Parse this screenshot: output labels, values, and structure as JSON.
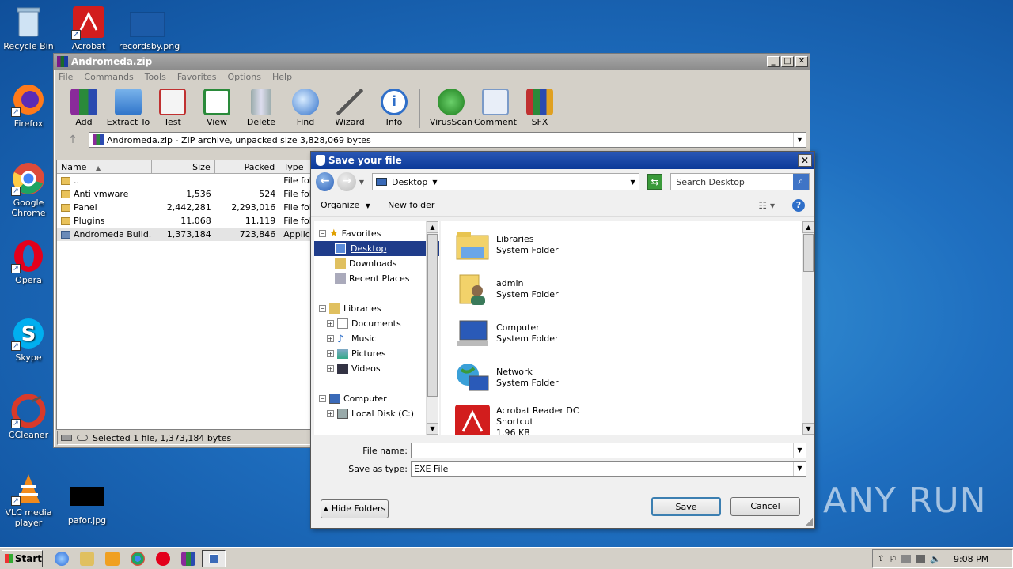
{
  "desktop": {
    "icons": [
      {
        "label": "Recycle Bin"
      },
      {
        "label": "Acrobat"
      },
      {
        "label": "recordsby.png"
      },
      {
        "label": "Firefox"
      },
      {
        "label": "Google Chrome"
      },
      {
        "label": "Opera"
      },
      {
        "label": "Skype"
      },
      {
        "label": "CCleaner"
      },
      {
        "label": "VLC media player"
      },
      {
        "label": "pafor.jpg"
      }
    ],
    "watermark": "ANY RUN"
  },
  "winrar": {
    "title": "Andromeda.zip",
    "menu": [
      "File",
      "Commands",
      "Tools",
      "Favorites",
      "Options",
      "Help"
    ],
    "toolbar": [
      "Add",
      "Extract To",
      "Test",
      "View",
      "Delete",
      "Find",
      "Wizard",
      "Info",
      "VirusScan",
      "Comment",
      "SFX"
    ],
    "address": "Andromeda.zip - ZIP archive, unpacked size 3,828,069 bytes",
    "columns": [
      "Name",
      "Size",
      "Packed",
      "Type"
    ],
    "rows": [
      {
        "name": "..",
        "size": "",
        "packed": "",
        "type": "File fold"
      },
      {
        "name": "Anti vmware",
        "size": "1,536",
        "packed": "524",
        "type": "File fold"
      },
      {
        "name": "Panel",
        "size": "2,442,281",
        "packed": "2,293,016",
        "type": "File fold"
      },
      {
        "name": "Plugins",
        "size": "11,068",
        "packed": "11,119",
        "type": "File fold"
      },
      {
        "name": "Andromeda Build...",
        "size": "1,373,184",
        "packed": "723,846",
        "type": "Applica"
      }
    ],
    "status": "Selected 1 file, 1,373,184 bytes"
  },
  "dialog": {
    "title": "Save your file",
    "path": "Desktop",
    "search_placeholder": "Search Desktop",
    "organize": "Organize",
    "new_folder": "New folder",
    "tree": {
      "favorites": "Favorites",
      "desktop": "Desktop",
      "downloads": "Downloads",
      "recent": "Recent Places",
      "libraries": "Libraries",
      "documents": "Documents",
      "music": "Music",
      "pictures": "Pictures",
      "videos": "Videos",
      "computer": "Computer",
      "localdisk": "Local Disk (C:)"
    },
    "files": [
      {
        "name": "Libraries",
        "type": "System Folder",
        "extra": ""
      },
      {
        "name": "admin",
        "type": "System Folder",
        "extra": ""
      },
      {
        "name": "Computer",
        "type": "System Folder",
        "extra": ""
      },
      {
        "name": "Network",
        "type": "System Folder",
        "extra": ""
      },
      {
        "name": "Acrobat Reader DC",
        "type": "Shortcut",
        "extra": "1.96 KB"
      }
    ],
    "filename_label": "File name:",
    "filename_value": "",
    "savetype_label": "Save as type:",
    "savetype_value": "EXE File",
    "hide_folders": "Hide Folders",
    "save": "Save",
    "cancel": "Cancel"
  },
  "taskbar": {
    "start": "Start",
    "time": "9:08 PM"
  }
}
